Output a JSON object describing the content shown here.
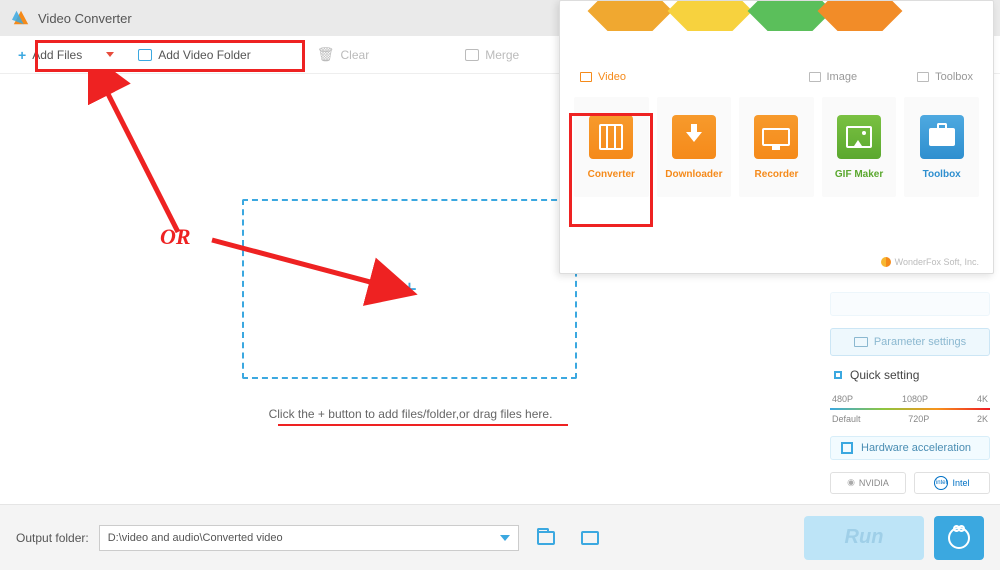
{
  "title": "Video Converter",
  "toolbar": {
    "add_files": "Add Files",
    "add_video_folder": "Add Video Folder",
    "clear": "Clear",
    "merge": "Merge"
  },
  "dropzone_hint": "Click the + button to add files/folder,or drag files here.",
  "sidebar": {
    "param_settings": "Parameter settings",
    "quick_setting": "Quick setting",
    "presets_top": [
      "480P",
      "1080P",
      "4K"
    ],
    "presets_bottom": [
      "Default",
      "720P",
      "2K"
    ],
    "hardware_accel": "Hardware acceleration",
    "vendors": [
      "NVIDIA",
      "Intel"
    ]
  },
  "output": {
    "label": "Output folder:",
    "path": "D:\\video and audio\\Converted video",
    "run": "Run"
  },
  "overlay": {
    "cats": {
      "video": "Video",
      "image": "Image",
      "toolbox": "Toolbox"
    },
    "tools": {
      "converter": "Converter",
      "downloader": "Downloader",
      "recorder": "Recorder",
      "gifmaker": "GIF Maker",
      "toolbox": "Toolbox"
    },
    "footer": "WonderFox Soft, Inc."
  },
  "annotation_or": "OR"
}
